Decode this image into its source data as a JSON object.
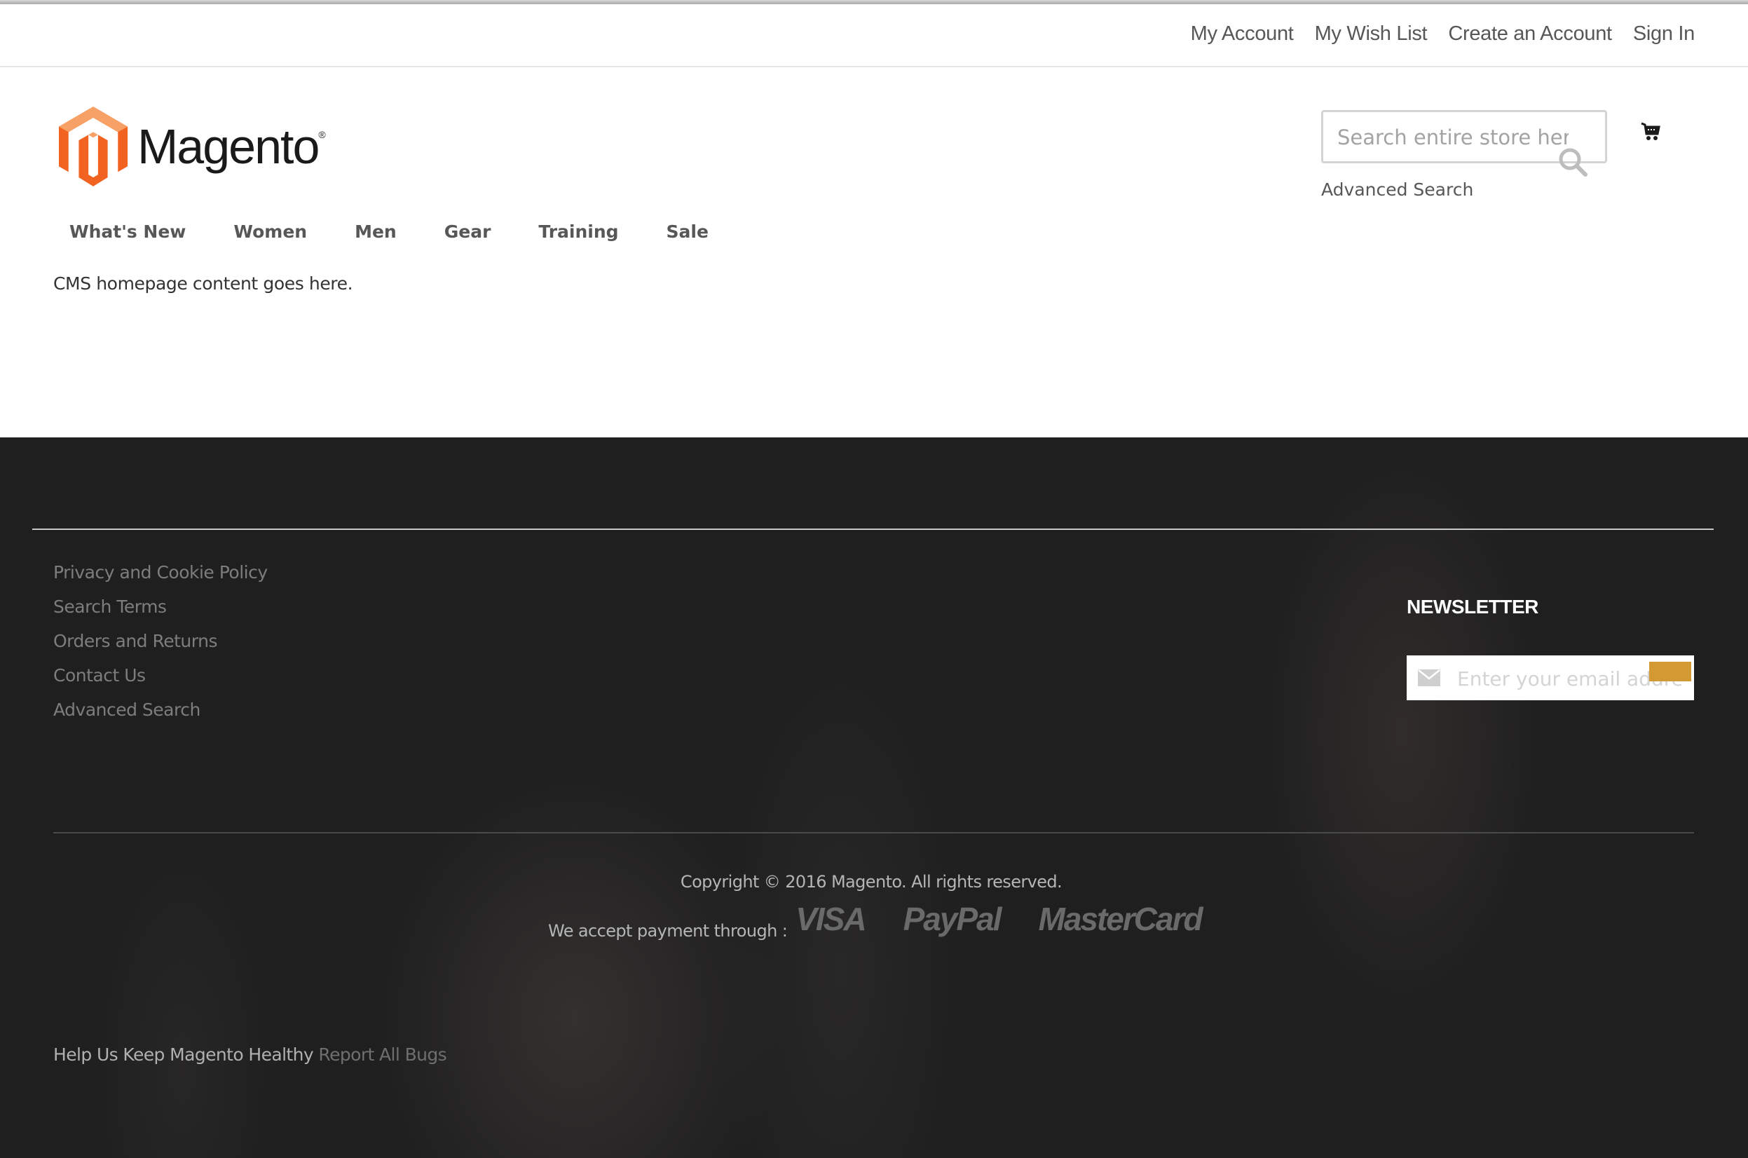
{
  "header": {
    "links": [
      "My Account",
      "My Wish List",
      "Create an Account",
      "Sign In"
    ]
  },
  "logo": {
    "text": "Magento",
    "trademark": "®",
    "colors": {
      "orange": "#f26322",
      "light_orange": "#f7a166"
    }
  },
  "search": {
    "placeholder": "Search entire store here...",
    "value": "",
    "advanced_search_label": "Advanced Search",
    "search_icon": "search-icon",
    "cart_icon": "cart-icon"
  },
  "nav": {
    "items": [
      "What's New",
      "Women",
      "Men",
      "Gear",
      "Training",
      "Sale"
    ]
  },
  "main": {
    "cms_text": "CMS homepage content goes here."
  },
  "footer": {
    "links": [
      "Privacy and Cookie Policy",
      "Search Terms",
      "Orders and Returns",
      "Contact Us",
      "Advanced Search"
    ],
    "newsletter": {
      "title": "NEWSLETTER",
      "placeholder": "Enter your email address",
      "value": "",
      "mail_icon": "mail-icon",
      "button_color": "#d39a33"
    },
    "copyright": "Copyright © 2016 Magento. All rights reserved.",
    "payment_label": "We accept payment through :",
    "payment_logos": [
      "VISA",
      "PayPal",
      "MasterCard"
    ],
    "help_text": "Help Us Keep Magento Healthy",
    "report_link": "Report All Bugs",
    "background_color": "#1f1f20"
  }
}
